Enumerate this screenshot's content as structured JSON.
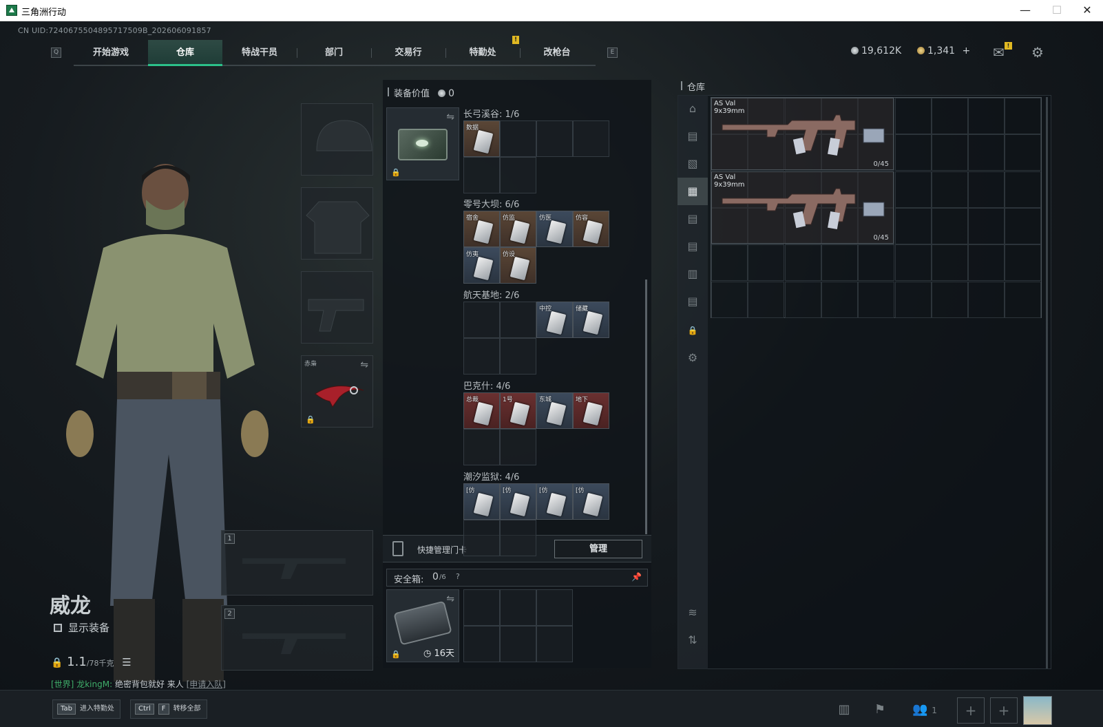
{
  "window": {
    "title": "三角洲行动",
    "min": "—",
    "max": "☐",
    "close": "✕"
  },
  "uid": "CN UID:7240675504895717509B_202606091857",
  "nav": {
    "left_key": "Q",
    "right_key": "E",
    "tabs": [
      "开始游戏",
      "仓库",
      "特战干员",
      "部门",
      "交易行",
      "特勤处",
      "改枪台"
    ],
    "active": "仓库",
    "alert": "!"
  },
  "currency": {
    "silver": "19,612K",
    "gold": "1,341",
    "plus": "+"
  },
  "mail_badge": "!",
  "character": {
    "name": "威龙",
    "show_equip": "显示装备",
    "weight_value": "1.1",
    "weight_max": "/78千克"
  },
  "chat": {
    "channel": "[世界]",
    "user": "龙kingM:",
    "message": "绝密背包就好 来人",
    "link": "[申请入队]"
  },
  "equip_slots": {
    "melee_label": "赤枭",
    "slot1": "1",
    "slot2": "2"
  },
  "equip_value": {
    "label": "装备价值",
    "value": "0"
  },
  "regions": [
    {
      "title": "长弓溪谷: 1/6",
      "items": [
        {
          "label": "数据",
          "color": "brown"
        }
      ]
    },
    {
      "title": "零号大坝: 6/6",
      "items": [
        {
          "label": "宿舍",
          "color": "brown"
        },
        {
          "label": "仿监",
          "color": "brown"
        },
        {
          "label": "仿医",
          "color": "blue"
        },
        {
          "label": "仿容",
          "color": "brown"
        },
        {
          "label": "仿夷",
          "color": "blue"
        },
        {
          "label": "仿设",
          "color": "brown"
        }
      ]
    },
    {
      "title": "航天基地: 2/6",
      "items": [
        {
          "label": "中控",
          "color": "blue"
        },
        {
          "label": "储藏",
          "color": "blue"
        }
      ]
    },
    {
      "title": "巴克什: 4/6",
      "items": [
        {
          "label": "总裁",
          "color": "red"
        },
        {
          "label": "1号",
          "color": "red"
        },
        {
          "label": "东城",
          "color": "blue"
        },
        {
          "label": "地下",
          "color": "red"
        }
      ]
    },
    {
      "title": "潮汐监狱: 4/6",
      "items": [
        {
          "label": "[仿",
          "color": "blue"
        },
        {
          "label": "[仿",
          "color": "blue"
        },
        {
          "label": "[仿",
          "color": "blue"
        },
        {
          "label": "[仿",
          "color": "blue"
        }
      ]
    }
  ],
  "quick_manage": {
    "label": "快捷管理门卡",
    "button": "管理"
  },
  "safe_box": {
    "label": "安全箱:",
    "value": "0",
    "max": "/6",
    "help": "?",
    "days": "16天"
  },
  "warehouse": {
    "title": "仓库",
    "guns": [
      {
        "name": "AS Val",
        "caliber": "9x39mm",
        "ammo": "0/45"
      },
      {
        "name": "AS Val",
        "caliber": "9x39mm",
        "ammo": "0/45"
      }
    ]
  },
  "bottom": {
    "tab_key": "Tab",
    "tab_label": "进入特勤处",
    "ctrl_key": "Ctrl",
    "f_key": "F",
    "ctrl_label": "转移全部",
    "team_count": "1"
  },
  "colors": {
    "accent": "#2cc18a",
    "brown_item": "#5a4636",
    "blue_item": "#3c4a5c",
    "red_item": "#6a3030",
    "chat_link": "#3fae6a"
  }
}
